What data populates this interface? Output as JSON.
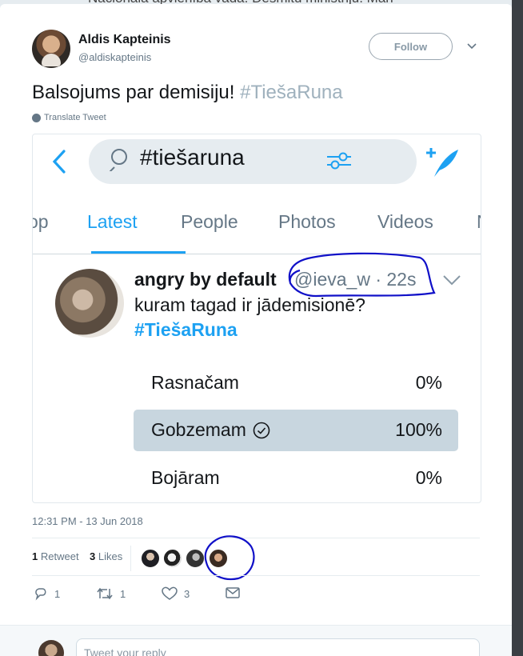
{
  "background": {
    "partial_text": "Nacionālā apvienība vadā. Desmitu ministriju. Man"
  },
  "author": {
    "name": "Aldis Kapteinis",
    "handle": "@aldiskapteinis"
  },
  "follow_label": "Follow",
  "tweet": {
    "text": "Balsojums par demisiju! ",
    "hashtag": "#TiešaRuna",
    "translate_label": "Translate Tweet"
  },
  "embedded": {
    "search_text": "#tiešaruna",
    "tabs": [
      {
        "label": "op"
      },
      {
        "label": "Latest",
        "active": true
      },
      {
        "label": "People"
      },
      {
        "label": "Photos"
      },
      {
        "label": "Videos"
      },
      {
        "label": "N"
      }
    ],
    "tweet": {
      "name": "angry by default",
      "handle_time": "@ieva_w · 22s",
      "text": "kuram tagad ir jādemisionē?",
      "hashtag": "#TiešaRuna"
    },
    "poll": [
      {
        "label": "Rasnačam",
        "pct": "0%",
        "winner": false
      },
      {
        "label": "Gobzemam",
        "pct": "100%",
        "winner": true
      },
      {
        "label": "Bojāram",
        "pct": "0%",
        "winner": false
      }
    ]
  },
  "timestamp": "12:31 PM - 13 Jun 2018",
  "stats": {
    "retweets_count": "1",
    "retweets_label": "Retweet",
    "likes_count": "3",
    "likes_label": "Likes"
  },
  "actions": {
    "reply_count": "1",
    "retweet_count": "1",
    "like_count": "3"
  },
  "reply_placeholder": "Tweet your reply",
  "colors": {
    "accent": "#1da1f2",
    "annotation": "#1010c8",
    "poll_winner": "#c8d6df"
  }
}
